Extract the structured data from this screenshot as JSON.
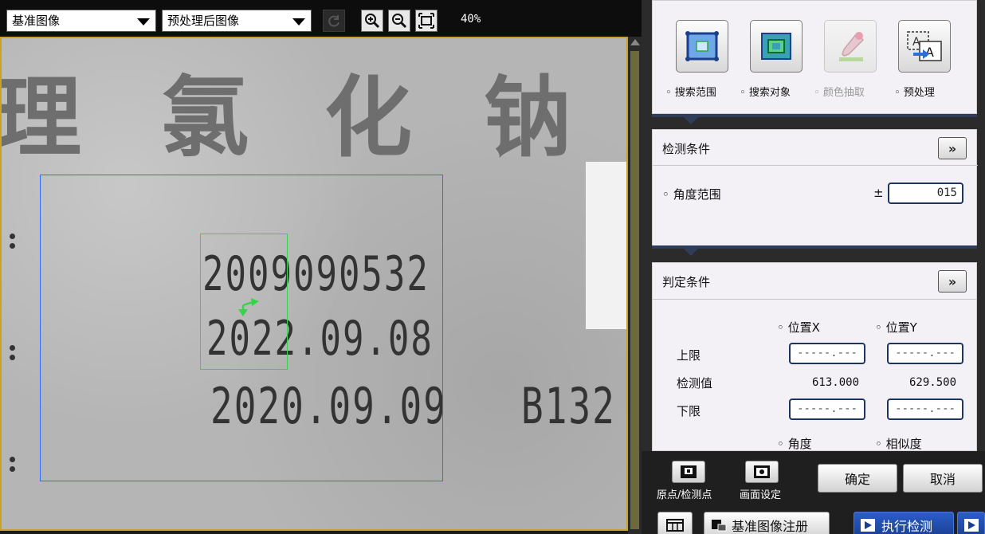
{
  "toolbar": {
    "image_select": "基准图像",
    "preprocess_select": "预处理后图像",
    "zoom_level": "40%"
  },
  "viewer": {
    "big_chars": [
      "理",
      "氯",
      "化",
      "钠"
    ],
    "print_lines": [
      "2009090532",
      "2022.09.08",
      "2020.09.09",
      "B132"
    ]
  },
  "tools": {
    "search_range": "搜索范围",
    "search_target": "搜索对象",
    "color_extract": "颜色抽取",
    "preprocess": "预处理"
  },
  "detection": {
    "title": "检测条件",
    "more": "»",
    "angle_range_label": "角度范围",
    "plus_minus": "±",
    "angle_range_value": "015"
  },
  "judgement": {
    "title": "判定条件",
    "more": "»",
    "col_x": "位置X",
    "col_y": "位置Y",
    "upper_label": "上限",
    "measured_label": "检测值",
    "lower_label": "下限",
    "upper_x": "-----.---",
    "upper_y": "-----.---",
    "measured_x": "613.000",
    "measured_y": "629.500",
    "lower_x": "-----.---",
    "lower_y": "-----.---",
    "col_angle": "角度",
    "col_similarity": "相似度"
  },
  "footer": {
    "origin_label": "原点/检测点",
    "screen_label": "画面设定",
    "ok": "确定",
    "cancel": "取消",
    "register_label": "基准图像注册",
    "run_label": "执行检测"
  }
}
